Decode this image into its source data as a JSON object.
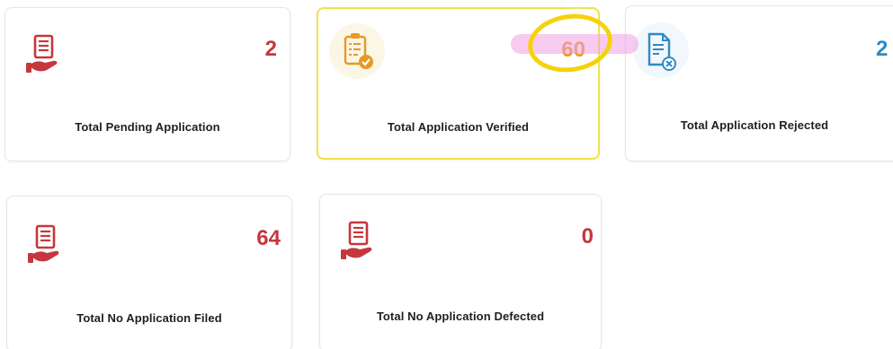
{
  "colors": {
    "pending_accent": "#c5373d",
    "verified_accent": "#e69a24",
    "rejected_accent": "#2e8ac6",
    "label_text": "#1f1f1f",
    "highlight_marker": "#f0a0e1",
    "circle_marker": "#f5d20e"
  },
  "cards": {
    "pending": {
      "count": "2",
      "label": "Total Pending Application",
      "icon": "hand-document-icon"
    },
    "verified": {
      "count": "60",
      "label": "Total Application Verified",
      "icon": "clipboard-check-icon"
    },
    "rejected": {
      "count": "2",
      "label": "Total Application Rejected",
      "icon": "document-reject-icon"
    },
    "no_filed": {
      "count": "64",
      "label": "Total No Application Filed",
      "icon": "hand-document-icon"
    },
    "defected": {
      "count": "0",
      "label": "Total No Application Defected",
      "icon": "hand-document-icon"
    }
  }
}
